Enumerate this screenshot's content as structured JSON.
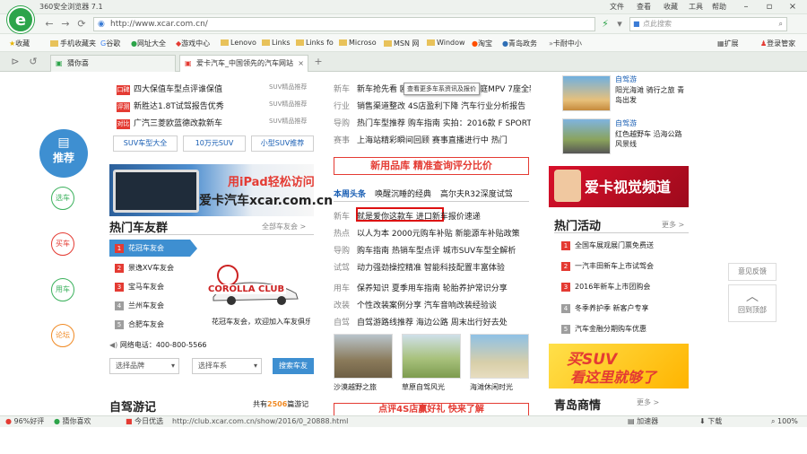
{
  "browser": {
    "title": "360安全浏览器 7.1",
    "menu": [
      "文件",
      "查看",
      "收藏",
      "工具",
      "帮助"
    ],
    "url": "http://www.xcar.com.cn/",
    "search_placeholder": "点此搜索",
    "bookmarks": [
      "收藏",
      "手机收藏夹",
      "谷歌",
      "网址大全",
      "游戏中心",
      "Lenovo",
      "Links",
      "Links fo",
      "Microso",
      "MSN 网",
      "Window",
      "淘宝",
      "青岛政务",
      "卡耐中小"
    ],
    "bookmark_right": [
      "扩展",
      "登录管家"
    ],
    "tabs": [
      {
        "label": "猜你喜"
      },
      {
        "label": "爱卡汽车_中国领先的汽车网站"
      }
    ],
    "accent": "#2da44a"
  },
  "sidebar": {
    "recommend": "推荐",
    "items": [
      "选车",
      "买车",
      "用车",
      "论坛"
    ]
  },
  "left": {
    "news": [
      {
        "tag": "口碑",
        "text": "四大保值车型点评谁保值",
        "meta": "SUV精品推荐"
      },
      {
        "tag": "评测",
        "text": "新胜达1.8T试驾报告优秀",
        "meta": "SUV精品推荐"
      },
      {
        "tag": "对比",
        "text": "广汽三菱欧蓝德改款新车",
        "meta": "SUV精品推荐"
      }
    ],
    "pills": [
      "SUV车型大全",
      "10万元SUV",
      "小型SUV推荐"
    ],
    "banner_top": "用iPad轻松访问",
    "banner_main": "爱卡汽车xcar.com.cn",
    "hot_club_title": "热门车友群",
    "hot_club_more": "全部车友会 >",
    "clubs": [
      "花冠车友会",
      "景逸XV车友会",
      "宝马车友会",
      "兰州车友会",
      "合肥车友会"
    ],
    "club_logo": "COROLLA CLUB",
    "club_caption": "花冠车友会，欢迎加入车友俱乐部",
    "call_text": "网络电话：400-800-5566",
    "select1": "选择品牌",
    "select2": "选择车系",
    "find_btn": "搜索车友",
    "travel_title": "自驾游记",
    "travel_count_pre": "共有",
    "travel_count": "2506",
    "travel_count_post": "篇游记"
  },
  "middle": {
    "rows": [
      {
        "tag": "新车",
        "text": "新车抢先看 欧尚A800全新登场  家庭MPV 7座全新推出"
      },
      {
        "tag": "行业",
        "text": "销售渠道整改 4S店盈利下降  汽车行业分析报告"
      },
      {
        "tag": "导购",
        "text": "热门车型推荐 购车指南  实拍：2016款 F SPORT"
      },
      {
        "tag": "赛事",
        "text": "上海站精彩瞬间回顾  赛事直播进行中 热门"
      }
    ],
    "tooltip": "查看更多车系资讯及报价",
    "red_box": "新用品库 精准查询评分比价",
    "tabs": [
      "本周头条",
      "唤醒沉睡的经典",
      "高尔夫R32深度试驾"
    ],
    "highlight": "就是爱你这款车",
    "list": [
      {
        "tag": "新车",
        "text": "就是爱你这款车  进口新车报价速递"
      },
      {
        "tag": "热点",
        "text": "以人为本 2000元购车补贴  新能源车补贴政策"
      },
      {
        "tag": "导购",
        "text": "购车指南 热销车型点评  城市SUV车型全解析"
      },
      {
        "tag": "试驾",
        "text": "动力强劲操控精准  智能科技配置丰富体验"
      },
      {
        "tag": "用车",
        "text": "保养知识 夏季用车指南  轮胎养护常识分享"
      },
      {
        "tag": "改装",
        "text": "个性改装案例分享  汽车音响改装经验谈"
      },
      {
        "tag": "自驾",
        "text": "自驾游路线推荐 海边公路  周末出行好去处"
      }
    ],
    "captions": [
      "沙漠越野之旅",
      "草原自驾风光",
      "海滩休闲时光"
    ],
    "bottom_red": "点评4S店赢好礼 快来了解"
  },
  "right": {
    "news": [
      {
        "label": "自驾游",
        "text": "阳光海滩 骑行之旅 青岛出发"
      },
      {
        "label": "自驾游",
        "text": "红色越野车 沿海公路风景线"
      }
    ],
    "banner1": "爱卡视觉频道",
    "hot_title": "热门活动",
    "hot_more": "更多 >",
    "activities": [
      "全国车展观展门票免费送",
      "一汽丰田新车上市试驾会",
      "2016年新车上市团购会",
      "冬季养护季 新客户专享",
      "汽车金融分期购车优惠"
    ],
    "banner2_a": "买SUV",
    "banner2_b": "看这里就够了",
    "qd_title": "青岛商情",
    "qd_more": "更多 >"
  },
  "floating": {
    "feedback": "意见反馈",
    "top": "回到顶部"
  },
  "status": {
    "items": [
      "96%好评",
      "猜你喜欢",
      "今日优选"
    ],
    "link": "http://club.xcar.com.cn/show/2016/0_20888.html",
    "right": [
      "加速器",
      "下载",
      "100%"
    ]
  }
}
